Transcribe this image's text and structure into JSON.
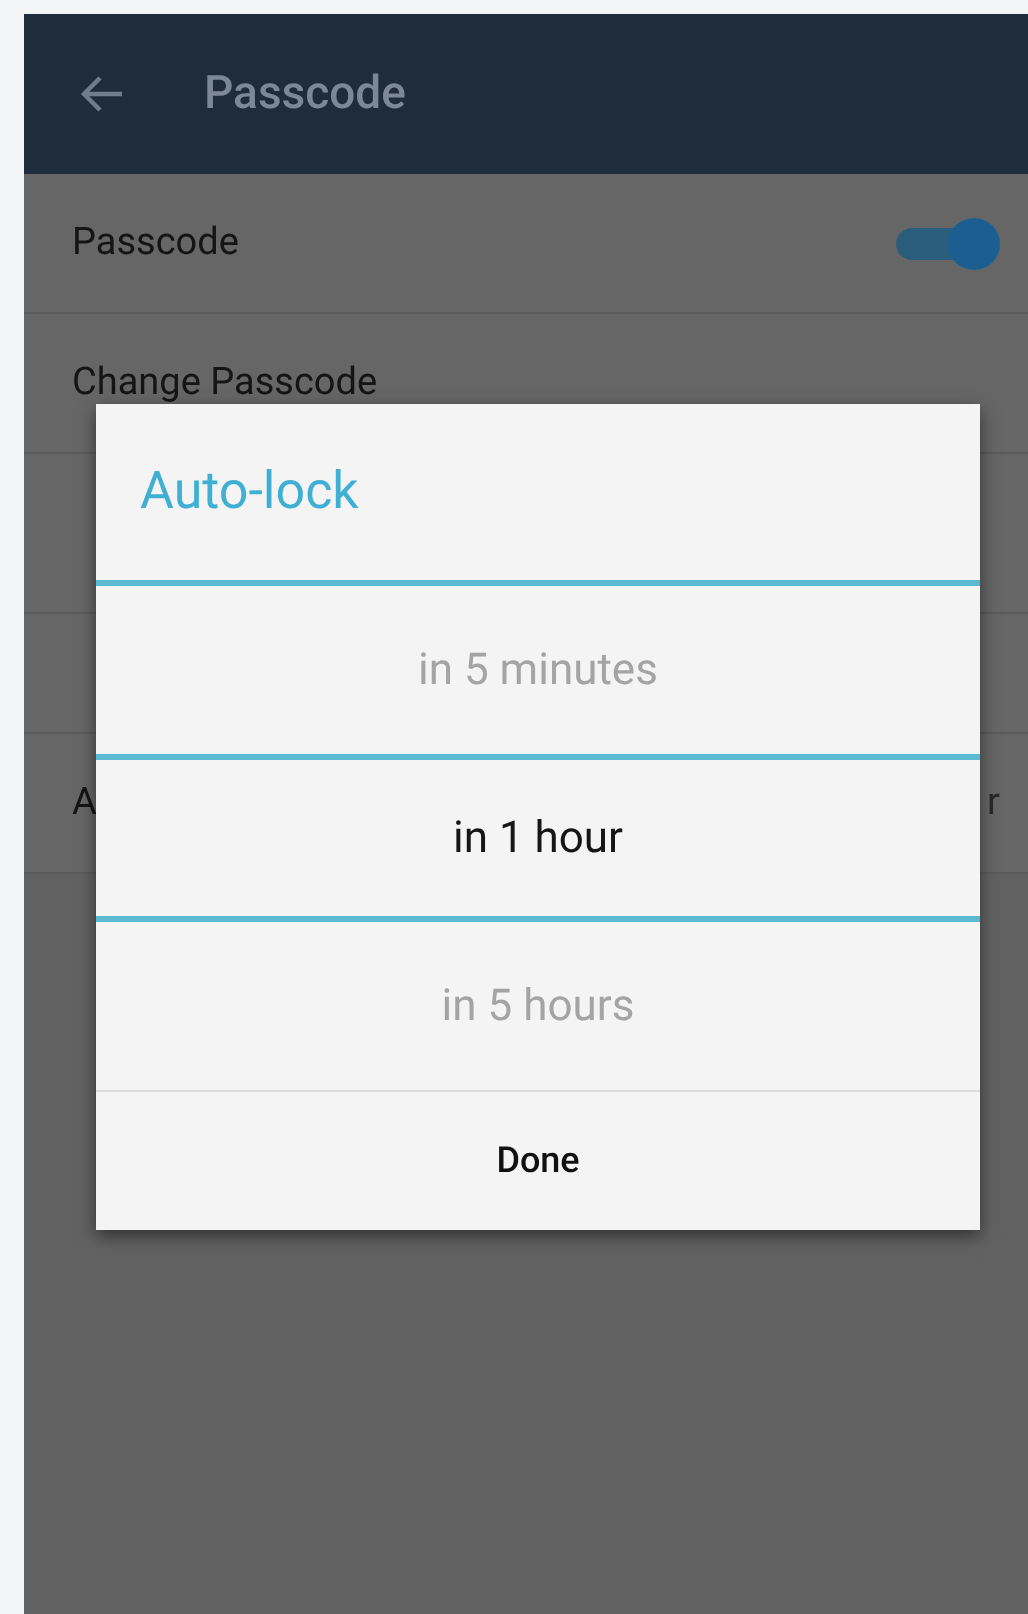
{
  "app_bar": {
    "title": "Passcode"
  },
  "settings": [
    {
      "kind": "toggle",
      "label": "Passcode",
      "on": true
    },
    {
      "kind": "link",
      "label": "Change Passcode"
    },
    {
      "kind": "value",
      "label": "A",
      "value": "r"
    }
  ],
  "dialog": {
    "title": "Auto-lock",
    "options": [
      {
        "label": "in 5 minutes",
        "selected": false
      },
      {
        "label": "in 1 hour",
        "selected": true
      },
      {
        "label": "in 5 hours",
        "selected": false
      }
    ],
    "button": "Done"
  }
}
